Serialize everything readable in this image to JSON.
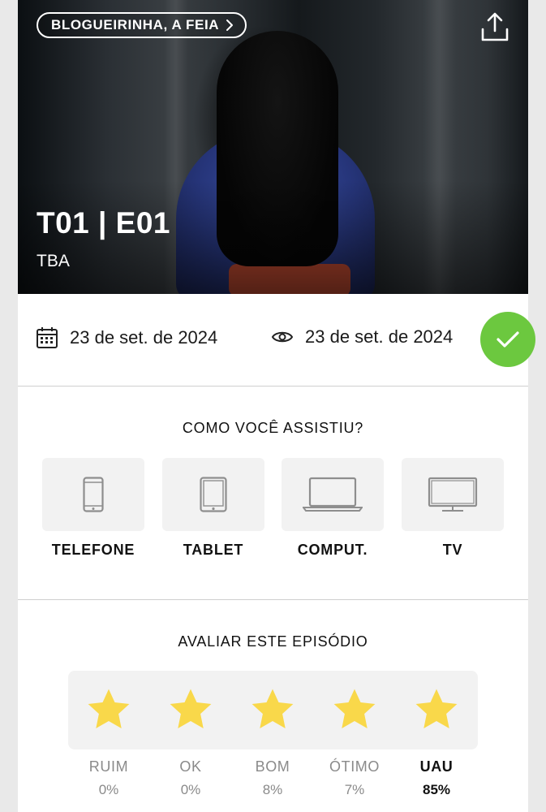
{
  "hero": {
    "show_name": "BLOGUEIRINHA, A FEIA",
    "episode_code": "T01 | E01",
    "episode_title": "TBA"
  },
  "dates": {
    "air_date": "23 de set. de 2024",
    "watched_date": "23 de set. de 2024",
    "watched_color": "#6cc83f"
  },
  "how_watched": {
    "title": "COMO VOCÊ ASSISTIU?",
    "devices": [
      {
        "label": "TELEFONE",
        "icon": "phone-icon"
      },
      {
        "label": "TABLET",
        "icon": "tablet-icon"
      },
      {
        "label": "COMPUT.",
        "icon": "laptop-icon"
      },
      {
        "label": "TV",
        "icon": "tv-icon"
      }
    ]
  },
  "rating": {
    "title": "AVALIAR ESTE EPISÓDIO",
    "star_color": "#f9d84a",
    "options": [
      {
        "name": "RUIM",
        "percent": "0%"
      },
      {
        "name": "OK",
        "percent": "0%"
      },
      {
        "name": "BOM",
        "percent": "8%"
      },
      {
        "name": "ÓTIMO",
        "percent": "7%"
      },
      {
        "name": "UAU",
        "percent": "85%"
      }
    ]
  }
}
